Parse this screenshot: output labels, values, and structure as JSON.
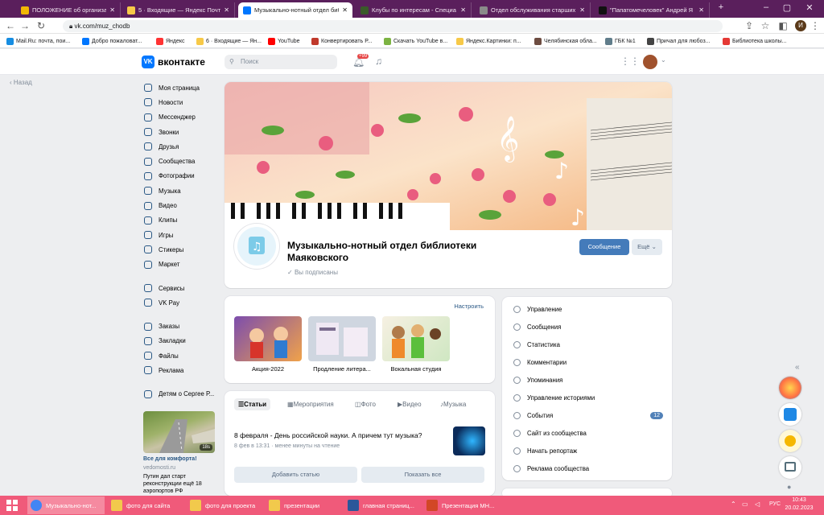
{
  "browser": {
    "tabs": [
      {
        "title": "ПОЛОЖЕНИЕ об организации",
        "favicon_color": "#f2b705"
      },
      {
        "title": "5 · Входящие — Яндекс Почта",
        "favicon_color": "#f7c948"
      },
      {
        "title": "Музыкально-нотный отдел биб",
        "favicon_color": "#0077ff"
      },
      {
        "title": "Клубы по интересам - Специа",
        "favicon_color": "#3a5a2a"
      },
      {
        "title": "Отдел обслуживания старших",
        "favicon_color": "#8a8a8a"
      },
      {
        "title": "\"Папатомечеловек\" Андрей Я",
        "favicon_color": "#111111"
      }
    ],
    "url": "vk.com/muz_chodb",
    "profile_initial": "И",
    "bookmarks": [
      {
        "label": "Mail.Ru: почта, пои...",
        "color": "#168de2"
      },
      {
        "label": "Добро пожаловат...",
        "color": "#0077ff"
      },
      {
        "label": "Яндекс",
        "color": "#ff3333"
      },
      {
        "label": "6 · Входящие — Ян...",
        "color": "#f7c948"
      },
      {
        "label": "YouTube",
        "color": "#ff0000"
      },
      {
        "label": "Конвертировать Р...",
        "color": "#c0392b"
      },
      {
        "label": "Скачать YouTube в...",
        "color": "#7cb342"
      },
      {
        "label": "Яндекс.Картинки: п...",
        "color": "#f7c948"
      },
      {
        "label": "Челябинская обла...",
        "color": "#6d4c41"
      },
      {
        "label": "ГБК №1",
        "color": "#607d8b"
      },
      {
        "label": "Причал для любоз...",
        "color": "#444444"
      },
      {
        "label": "Библиотека школы...",
        "color": "#e53935"
      }
    ]
  },
  "vk": {
    "logo": "вконтакте",
    "search_placeholder": "Поиск",
    "notif_badge": "99",
    "back": "Назад",
    "sidebar_main": [
      "Моя страница",
      "Новости",
      "Мессенджер",
      "Звонки",
      "Друзья",
      "Сообщества",
      "Фотографии",
      "Музыка",
      "Видео",
      "Клипы",
      "Игры",
      "Стикеры",
      "Маркет"
    ],
    "sidebar_mid": [
      "Сервисы",
      "VK Pay"
    ],
    "sidebar_lower": [
      "Заказы",
      "Закладки",
      "Файлы",
      "Реклама"
    ],
    "sidebar_friend_item": "Детям о Сергее Р...",
    "ad": {
      "duration": "18s",
      "title": "Все для комфорта!",
      "source": "vedomosti.ru",
      "text": "Путин дал старт реконструкции ещё 18 аэропортов РФ"
    },
    "group": {
      "title": "Музыкально-нотный отдел библиотеки Маяковского",
      "subscribed": "Вы подписаны",
      "message_button": "Сообщение",
      "more_button": "Ещё"
    },
    "albums": {
      "settings_link": "Настроить",
      "items": [
        "Акция-2022",
        "Продление литера...",
        "Вокальная студия"
      ]
    },
    "feed": {
      "tabs": [
        "Статьи",
        "Мероприятия",
        "Фото",
        "Видео",
        "Музыка"
      ],
      "article_title": "8 февраля - День российской науки. А причем тут музыка?",
      "article_meta": "8 фев в 13:31 · менее минуты на чтение",
      "add_button": "Добавить статью",
      "show_all_button": "Показать все"
    },
    "manage": {
      "items": [
        "Управление",
        "Сообщения",
        "Статистика",
        "Комментарии",
        "Упоминания",
        "Управление историями",
        "События",
        "Сайт из сообщества",
        "Начать репортаж",
        "Реклама сообщества"
      ],
      "events_badge": "12"
    }
  },
  "taskbar": {
    "items": [
      {
        "label": "Музыкально-нот...",
        "color": "#4285f4"
      },
      {
        "label": "фото для сайта",
        "color": "#f2c94c"
      },
      {
        "label": "фото для проекта",
        "color": "#f2c94c"
      },
      {
        "label": "презентации",
        "color": "#f2c94c"
      },
      {
        "label": "главная страниц...",
        "color": "#2b579a"
      },
      {
        "label": "Презентация МН...",
        "color": "#d24726"
      }
    ],
    "lang": "РУС",
    "time": "10:43",
    "date": "20.02.2023"
  }
}
